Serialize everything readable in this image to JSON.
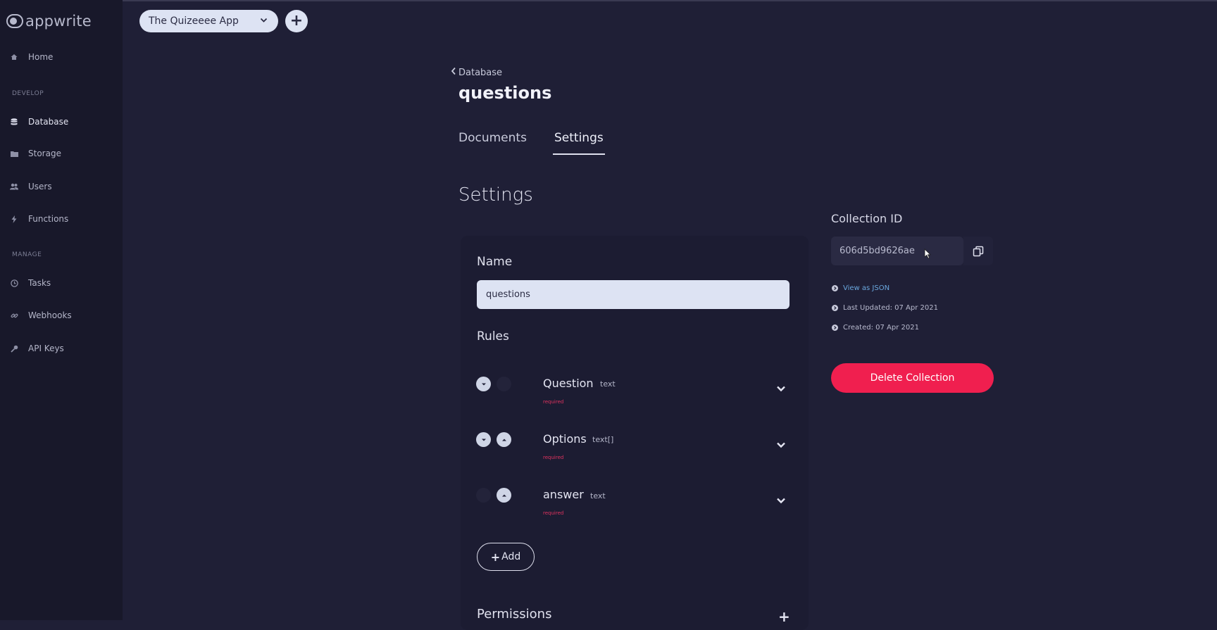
{
  "app": {
    "logo_text": "appwrite"
  },
  "sidebar": {
    "items": [
      {
        "label": "Home",
        "icon": "home-icon"
      },
      {
        "label": "Database",
        "icon": "database-icon",
        "active": true
      },
      {
        "label": "Storage",
        "icon": "folder-icon"
      },
      {
        "label": "Users",
        "icon": "users-icon"
      },
      {
        "label": "Functions",
        "icon": "lightning-icon"
      },
      {
        "label": "Tasks",
        "icon": "clock-icon"
      },
      {
        "label": "Webhooks",
        "icon": "link-icon"
      },
      {
        "label": "API Keys",
        "icon": "key-icon"
      }
    ],
    "sections": {
      "develop": "DEVELOP",
      "manage": "MANAGE"
    }
  },
  "topbar": {
    "project_name": "The Quizeeee App",
    "add_project_icon": "plus-icon"
  },
  "header": {
    "breadcrumb": "Database",
    "title": "questions",
    "tabs": [
      {
        "label": "Documents"
      },
      {
        "label": "Settings",
        "active": true
      }
    ]
  },
  "settings": {
    "heading": "Settings",
    "name_label": "Name",
    "name_value": "questions",
    "rules_label": "Rules",
    "rules": [
      {
        "name": "Question",
        "type": "text",
        "required": "required"
      },
      {
        "name": "Options",
        "type": "text[]",
        "required": "required"
      },
      {
        "name": "answer",
        "type": "text",
        "required": "required"
      }
    ],
    "add_label": "Add",
    "permissions_label": "Permissions"
  },
  "collection": {
    "id_label": "Collection ID",
    "id_value": "606d5bd9626ae",
    "view_json": "View as JSON",
    "last_updated": "Last Updated: 07 Apr 2021",
    "created": "Created: 07 Apr 2021",
    "delete_label": "Delete Collection"
  },
  "colors": {
    "background": "#1f1f36",
    "sidebar": "#18182a",
    "accent_danger": "#f01f4f",
    "link": "#6aa7de",
    "input_bg": "#dde3f3"
  }
}
